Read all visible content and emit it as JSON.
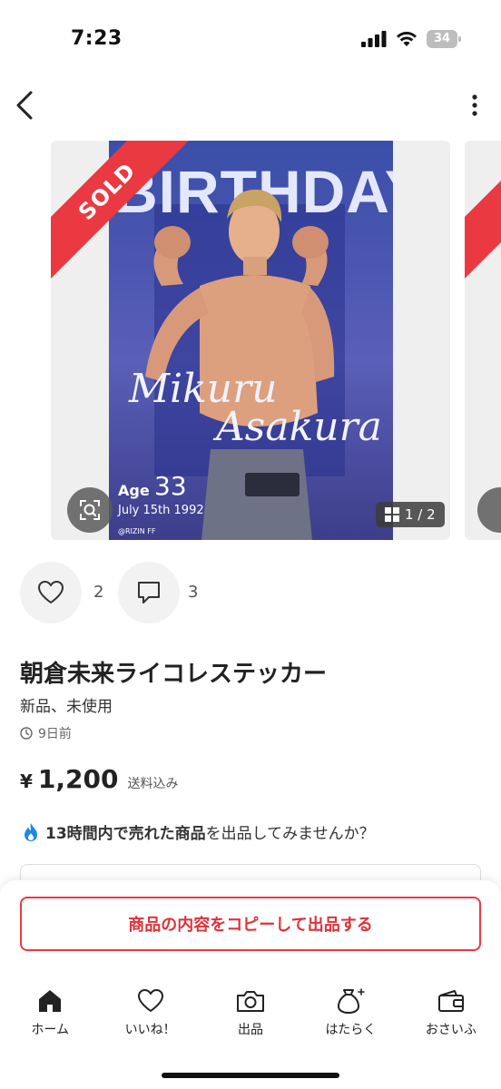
{
  "status_bar": {
    "time": "7:23",
    "battery": "34"
  },
  "header": {
    "back_icon": "chevron-left-icon",
    "more_icon": "more-vertical-icon"
  },
  "carousel": {
    "sold_label": "SOLD",
    "page_indicator": "1 / 2",
    "poster": {
      "heading": "BIRTHDAY",
      "name_line1": "Mikuru",
      "name_line2": "Asakura",
      "age_label": "Age",
      "age_value": "33",
      "birth_date": "July 15th 1992",
      "credit": "@RIZIN FF"
    }
  },
  "actions": {
    "like_count": "2",
    "comment_count": "3"
  },
  "item": {
    "title": "朝倉未来ライコレステッカー",
    "condition": "新品、未使用",
    "posted": "9日前",
    "price_symbol": "¥",
    "price": "1,200",
    "price_note": "送料込み"
  },
  "promo": {
    "strong_part": "13時間内で売れた商品",
    "rest": "を出品してみませんか？"
  },
  "copy_button": "商品の内容をコピーして出品する",
  "tabbar": {
    "items": [
      {
        "label": "ホーム",
        "icon": "home-icon",
        "active": true
      },
      {
        "label": "いいね！",
        "icon": "heart-icon"
      },
      {
        "label": "出品",
        "icon": "camera-icon"
      },
      {
        "label": "はたらく",
        "icon": "money-bag-icon"
      },
      {
        "label": "おさいふ",
        "icon": "wallet-icon"
      }
    ]
  },
  "colors": {
    "accent": "#ea3941",
    "text": "#222222",
    "promo_icon": "#1e88e5"
  }
}
